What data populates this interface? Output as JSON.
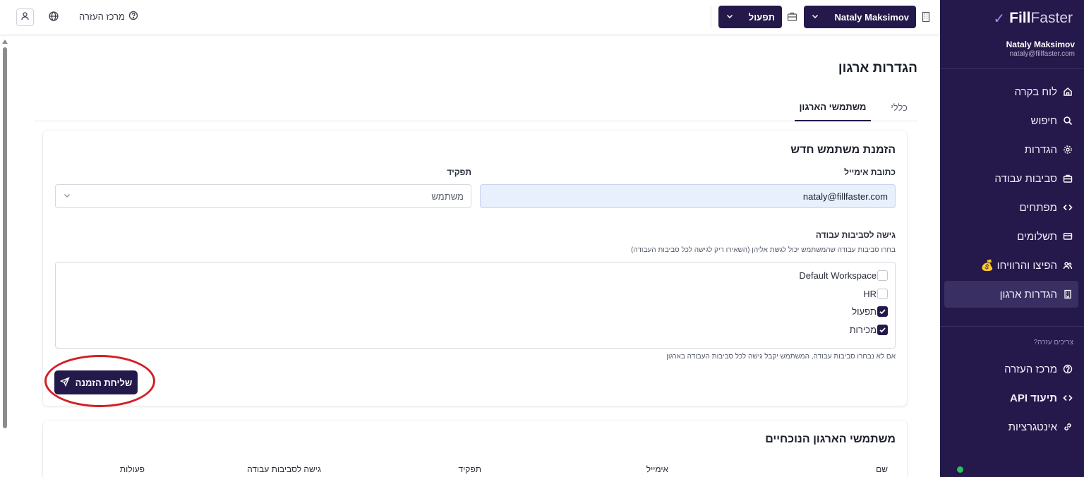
{
  "brand": {
    "name_bold": "Fill",
    "name_light": "Faster"
  },
  "sidebar": {
    "user_name": "Nataly Maksimov",
    "user_email": "nataly@fillfaster.com",
    "items": [
      {
        "label": "לוח בקרה",
        "icon": "home-icon"
      },
      {
        "label": "חיפוש",
        "icon": "search-icon"
      },
      {
        "label": "הגדרות",
        "icon": "gear-icon"
      },
      {
        "label": "סביבות עבודה",
        "icon": "briefcase-icon"
      },
      {
        "label": "מפתחים",
        "icon": "code-icon"
      },
      {
        "label": "תשלומים",
        "icon": "credit-card-icon"
      },
      {
        "label": "הפיצו והרוויחו 💰",
        "icon": "users-icon"
      },
      {
        "label": "הגדרות ארגון",
        "icon": "building-icon",
        "active": true
      }
    ],
    "help_label": "צריכים עזרה?",
    "help_items": [
      {
        "label": "מרכז העזרה",
        "icon": "help-circle-icon"
      },
      {
        "label": "תיעוד API",
        "icon": "code-icon"
      },
      {
        "label": "אינטגרציות",
        "icon": "link-icon"
      }
    ],
    "status_color": "#22c55e"
  },
  "topbar": {
    "org_name": "Nataly Maksimov",
    "workspace": "תפעול",
    "help_center": "מרכז העזרה"
  },
  "page": {
    "title": "הגדרות ארגון",
    "tabs": {
      "general": "כללי",
      "users": "משתמשי הארגון"
    }
  },
  "invite": {
    "title": "הזמנת משתמש חדש",
    "email_label": "כתובת אימייל",
    "email_value": "nataly@fillfaster.com",
    "role_label": "תפקיד",
    "role_value": "משתמש",
    "ws_label": "גישה לסביבות עבודה",
    "ws_hint": "בחרו סביבות עבודה שהמשתמש יכול לגשת אליהן (השאירו ריק לגישה לכל סביבות העבודה)",
    "workspaces": [
      {
        "name": "Default Workspace",
        "checked": false
      },
      {
        "name": "HR",
        "checked": false
      },
      {
        "name": "תפעול",
        "checked": true
      },
      {
        "name": "מכירות",
        "checked": true
      }
    ],
    "ws_footer": "אם לא נבחרו סביבות עבודה, המשתמש יקבל גישה לכל סביבות העבודה בארגון",
    "send_label": "שליחת הזמנה"
  },
  "members": {
    "title": "משתמשי הארגון הנוכחיים",
    "columns": {
      "name": "שם",
      "email": "אימייל",
      "role": "תפקיד",
      "access": "גישה לסביבות עבודה",
      "actions": "פעולות"
    }
  },
  "colors": {
    "primary": "#24194a",
    "accent": "#a78bfa",
    "highlight": "#d21f25"
  }
}
